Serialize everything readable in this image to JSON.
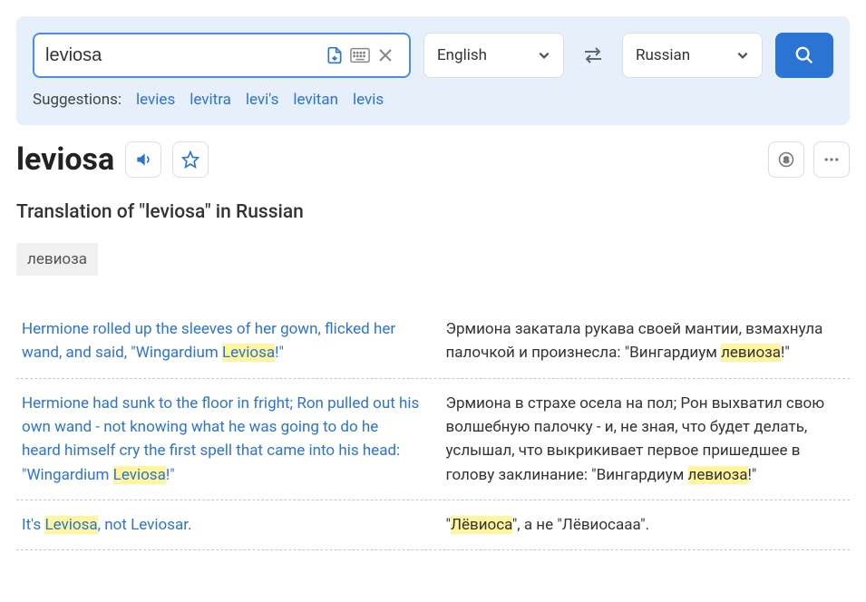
{
  "search": {
    "value": "leviosa",
    "source_lang": "English",
    "target_lang": "Russian"
  },
  "suggestions": {
    "label": "Suggestions:",
    "items": [
      "levies",
      "levitra",
      "levi's",
      "levitan",
      "levis"
    ]
  },
  "headword": "leviosa",
  "section_title": "Translation of \"leviosa\" in Russian",
  "translation_chip": "левиоза",
  "examples": [
    {
      "src_pre": "Hermione rolled up the sleeves of her gown, flicked her wand, and said, \"Wingardium ",
      "src_hl": "Leviosa",
      "src_post": "!\"",
      "tgt_pre": "Эрмиона закатала рукава своей мантии, взмахнула палочкой и произнесла: \"Вингардиум ",
      "tgt_hl": "левиоза",
      "tgt_post": "!\""
    },
    {
      "src_pre": "Hermione had sunk to the floor in fright; Ron pulled out his own wand - not knowing what he was going to do he heard himself cry the first spell that came into his head: \"Wingardium ",
      "src_hl": "Leviosa",
      "src_post": "!\"",
      "tgt_pre": "Эрмиона в страхе осела на пол; Рон выхватил свою волшебную палочку - и, не зная, что будет делать, услышал, что выкрикивает первое пришедшее в голову заклинание: \"Вингардиум ",
      "tgt_hl": "левиоза",
      "tgt_post": "!\""
    },
    {
      "src_pre": "It's ",
      "src_hl": "Leviosa",
      "src_post": ", not Leviosar.",
      "tgt_pre": "\"",
      "tgt_hl": "Лёвиоса",
      "tgt_post": "\", а не \"Лёвиосааа\"."
    }
  ]
}
